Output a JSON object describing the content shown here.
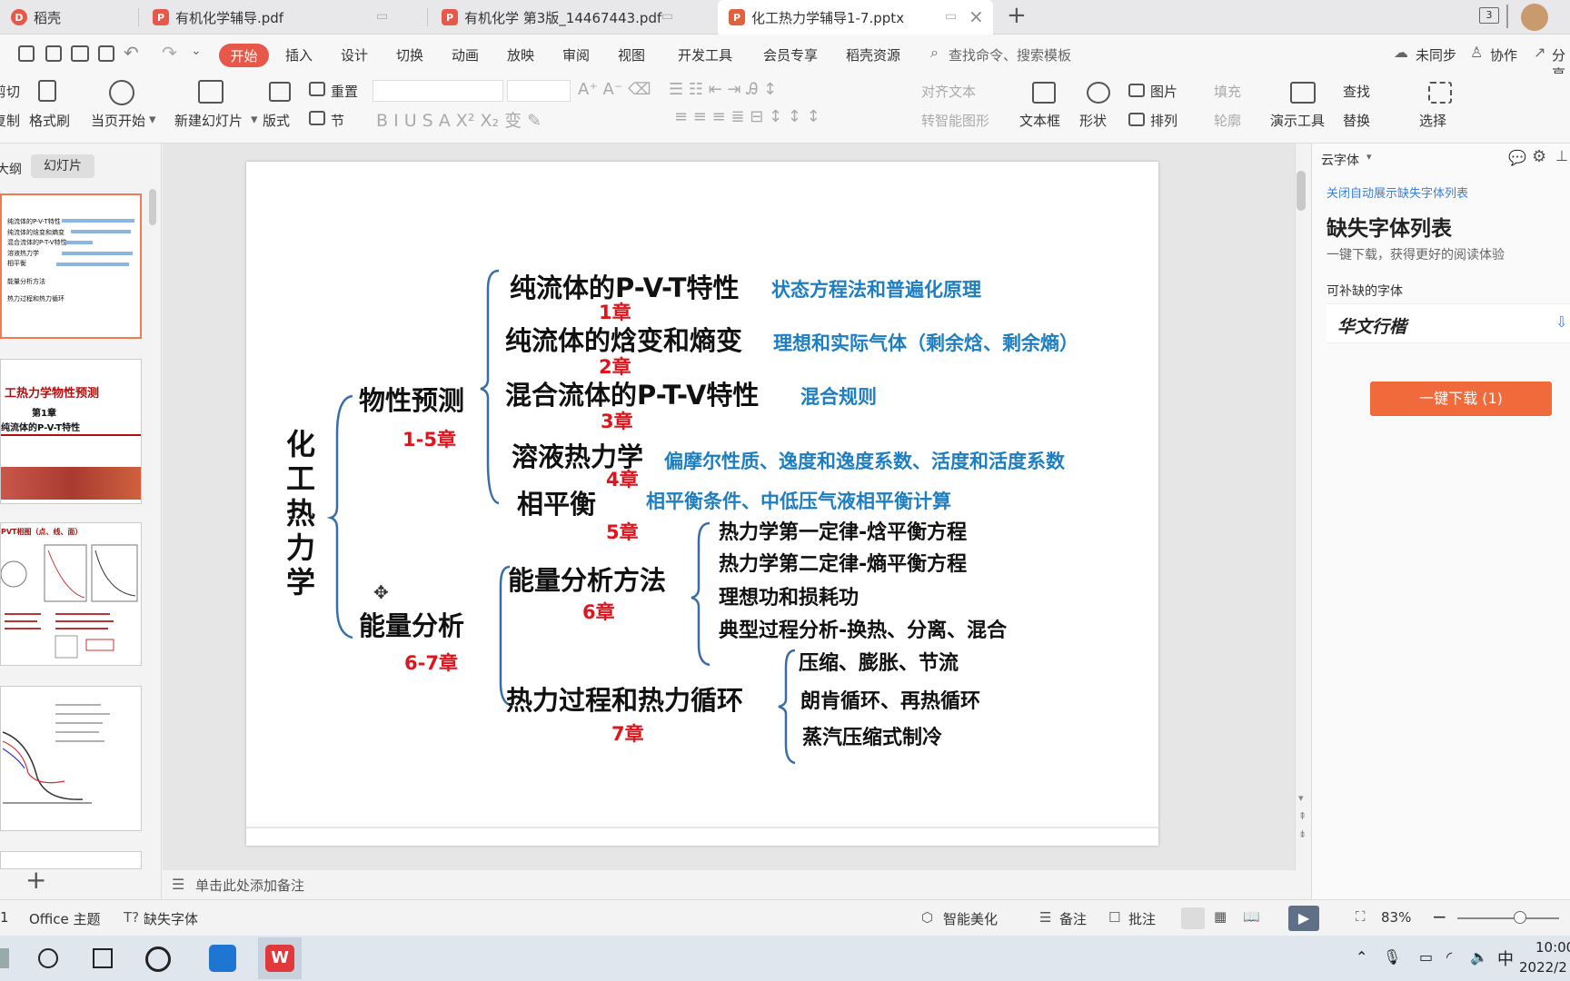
{
  "tabs": [
    {
      "label": "稻壳",
      "icon": "daoke-icon",
      "color": "#e8584a"
    },
    {
      "label": "有机化学辅导.pdf",
      "icon": "pdf-icon",
      "color": "#e8584a"
    },
    {
      "label": "有机化学 第3版_14467443.pdf",
      "icon": "pdf-icon",
      "color": "#e8584a"
    },
    {
      "label": "化工热力学辅导1-7.pptx",
      "icon": "ppt-icon",
      "color": "#e2603c"
    }
  ],
  "window": {
    "count_badge": "3"
  },
  "menu": {
    "start": "开始",
    "items": [
      "插入",
      "设计",
      "切换",
      "动画",
      "放映",
      "审阅",
      "视图",
      "开发工具",
      "会员专享",
      "稻壳资源"
    ],
    "search_placeholder": "查找命令、搜索模板",
    "sync": "未同步",
    "collab": "协作",
    "share": "分享"
  },
  "ribbon": {
    "cut": "剪切",
    "copy": "复制",
    "format_painter": "格式刷",
    "from_current": "当页开始",
    "new_slide": "新建幻灯片",
    "layout": "版式",
    "reset": "重置",
    "section": "节",
    "align_text": "对齐文本",
    "smart_shape": "转智能图形",
    "textbox": "文本框",
    "shape": "形状",
    "picture": "图片",
    "fill": "填充",
    "arrange": "排列",
    "outline": "轮廓",
    "present_tools": "演示工具",
    "find": "查找",
    "replace": "替换",
    "select": "选择"
  },
  "left_panel": {
    "outline_tab": "大纲",
    "slides_tab": "幻灯片"
  },
  "thumb1": {
    "lines": [
      "纯流体的P-V-T特性",
      "纯流体的焓变和熵变",
      "混合流体的P-T-V特性",
      "溶液热力学",
      "相平衡",
      "能量分析方法",
      "热力过程和热力循环"
    ]
  },
  "thumb2": {
    "title": "工热力学物性预测",
    "chapter": "第1章",
    "subtitle": "纯流体的P-V-T特性"
  },
  "thumb3": {
    "title": "PVT相图（点、线、面）"
  },
  "slide": {
    "root": "化工热力学",
    "branch1": {
      "label": "物性预测",
      "chapters": "1-5章"
    },
    "branch2": {
      "label": "能量分析",
      "chapters": "6-7章"
    },
    "topics": [
      {
        "title": "纯流体的P-V-T特性",
        "chapter": "1章",
        "detail": "状态方程法和普遍化原理"
      },
      {
        "title": "纯流体的焓变和熵变",
        "chapter": "2章",
        "detail": "理想和实际气体（剩余焓、剩余熵）"
      },
      {
        "title": "混合流体的P-T-V特性",
        "chapter": "3章",
        "detail": "混合规则"
      },
      {
        "title": "溶液热力学",
        "chapter": "4章",
        "detail": "偏摩尔性质、逸度和逸度系数、活度和活度系数"
      },
      {
        "title": "相平衡",
        "chapter": "5章",
        "detail": "相平衡条件、中低压气液相平衡计算"
      }
    ],
    "energy_method": {
      "title": "能量分析方法",
      "chapter": "6章",
      "items": [
        "热力学第一定律-焓平衡方程",
        "热力学第二定律-熵平衡方程",
        "理想功和损耗功",
        "典型过程分析-换热、分离、混合"
      ]
    },
    "thermo_cycle": {
      "title": "热力过程和热力循环",
      "chapter": "7章",
      "items": [
        "压缩、膨胀、节流",
        "朗肯循环、再热循环",
        "蒸汽压缩式制冷"
      ]
    }
  },
  "right_panel": {
    "header": "云字体",
    "close_link": "关闭自动展示缺失字体列表",
    "title": "缺失字体列表",
    "subtitle": "一键下载，获得更好的阅读体验",
    "section": "可补缺的字体",
    "font_name": "华文行楷",
    "download_button": "一键下载 (1)",
    "accent": "#f06a3c"
  },
  "notes": {
    "placeholder": "单击此处添加备注"
  },
  "status": {
    "page": "1",
    "theme": "Office 主题",
    "missing_font": "缺失字体",
    "beautify": "智能美化",
    "notes": "备注",
    "comment": "批注",
    "zoom": "83%"
  },
  "taskbar": {
    "ime": "中",
    "time": "10:00",
    "date": "2022/2"
  }
}
